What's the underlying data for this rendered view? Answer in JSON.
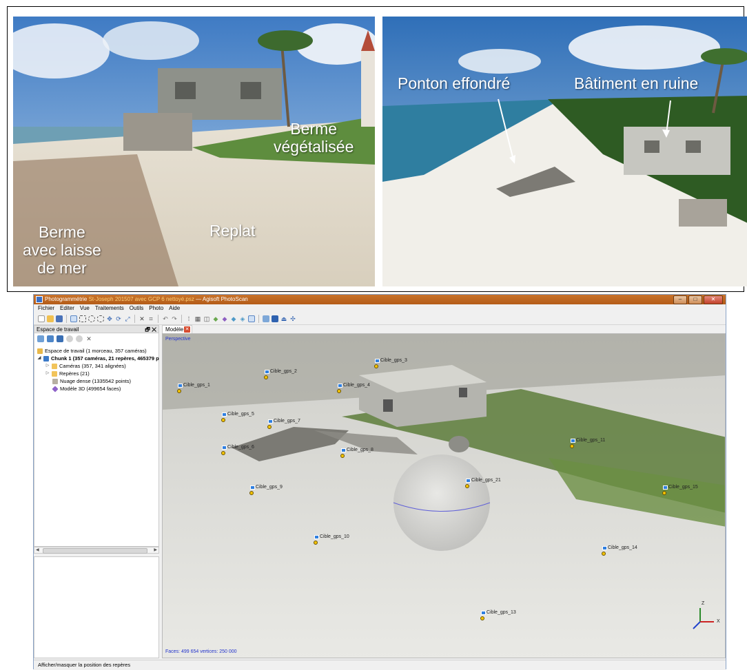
{
  "photos": {
    "left": {
      "labels": {
        "berme_vegetalisee": [
          "Berme",
          "végétalisée"
        ],
        "replat": "Replat",
        "berme_laisse": [
          "Berme",
          "avec laisse",
          "de mer"
        ]
      }
    },
    "right": {
      "labels": {
        "ponton": "Ponton effondré",
        "batiment": "Bâtiment en ruine"
      }
    }
  },
  "app": {
    "title_prefix": "Photogrammétrie",
    "title_accent": "St-Joseph 201507 avec GCP 6 nettoyé.psz",
    "title_suffix": "— Agisoft PhotoScan",
    "window_buttons": [
      "–",
      "□",
      "✕"
    ],
    "menu": [
      "Fichier",
      "Editer",
      "Vue",
      "Traitements",
      "Outils",
      "Photo",
      "Aide"
    ],
    "toolbar_icons": [
      "new-icon",
      "open-icon",
      "save-icon",
      "select-icon",
      "rect-select-icon",
      "circle-select-icon",
      "lasso-icon",
      "move-icon",
      "rotate-icon",
      "resize-icon",
      "delete-icon",
      "crop-icon",
      "undo-icon",
      "redo-icon",
      "points-icon",
      "dense-icon",
      "wireframe-icon",
      "solid-icon",
      "textured-icon",
      "shaded-icon",
      "cameras-icon",
      "reset-view-icon",
      "perspective-icon",
      "ortho-icon",
      "navigation-icon"
    ],
    "workspace": {
      "header": "Espace de travail",
      "header_buttons": "🗗 ✕",
      "tree": [
        {
          "label": "Espace de travail (1 morceau, 357 caméras)",
          "bold": false
        },
        {
          "label": "Chunk 1 (357 caméras, 21 repères, 465379 p",
          "bold": true
        },
        {
          "label": "Caméras (357, 341 alignées)",
          "bold": false
        },
        {
          "label": "Repères (21)",
          "bold": false
        },
        {
          "label": "Nuage dense (1335542 points)",
          "bold": false
        },
        {
          "label": "Modèle 3D (499654 faces)",
          "bold": false
        }
      ]
    },
    "model_tab": "Modèle",
    "viewport": {
      "mode": "Perspective",
      "stats": "Faces: 499 654 vertices: 250 000",
      "axis": {
        "z": "Z",
        "x": "X"
      },
      "markers": [
        "Cible_gps_1",
        "Cible_gps_2",
        "Cible_gps_3",
        "Cible_gps_4",
        "Cible_gps_5",
        "Cible_gps_7",
        "Cible_gps_6",
        "Cible_gps_8",
        "Cible_gps_11",
        "Cible_gps_21",
        "Cible_gps_9",
        "Cible_gps_15",
        "Cible_gps_10",
        "Cible_gps_14",
        "Cible_gps_13"
      ]
    },
    "status": "Afficher/masquer la position des repères"
  },
  "colors": {
    "titlebar": "#c8732b",
    "marker_flag": "#2f7fe0",
    "marker_pin": "#f2c200",
    "viewport_text": "#2233cc"
  }
}
